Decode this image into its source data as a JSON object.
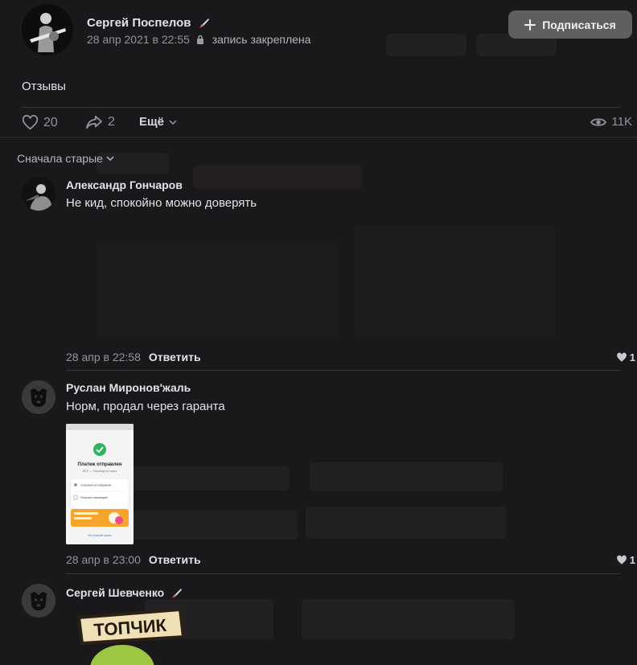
{
  "post": {
    "author": "Сергей Поспелов",
    "date": "28 апр 2021 в 22:55",
    "pinned": "запись закреплена",
    "subscribe": "Подписаться",
    "text": "Отзывы",
    "likes": "20",
    "shares": "2",
    "more": "Ещё",
    "views": "11K"
  },
  "sort_label": "Сначала старые",
  "comments": [
    {
      "author": "Александр Гончаров",
      "text": "Не кид, спокойно можно доверять",
      "date": "28 апр в 22:58",
      "reply": "Ответить",
      "likes": "1"
    },
    {
      "author": "Руслан Миронов'жаль",
      "text": "Норм, продал через гаранта",
      "date": "28 апр в 23:00",
      "reply": "Ответить",
      "likes": "1",
      "attachment": {
        "title": "Платеж отправлен",
        "subtitle": "85 ₽ — Перевод на карту",
        "item1": "Сохранить в избранное",
        "item2": "Получить квитанцию",
        "footer": "На главный экран"
      }
    },
    {
      "author": "Сергей Шевченко",
      "sticker_text": "ТОПЧИК"
    }
  ],
  "colors": {
    "background": "#19191b",
    "text": "#e1e3e6",
    "secondary": "#939598",
    "button": "#5f5f61",
    "success": "#2fb35f",
    "promo": "#f7a42c"
  }
}
